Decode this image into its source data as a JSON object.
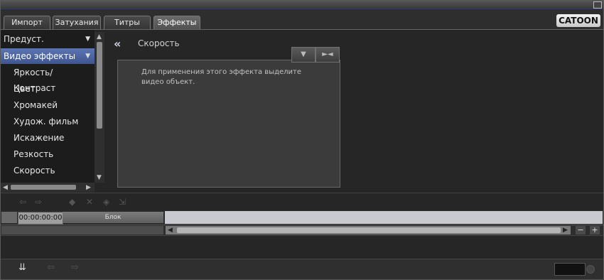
{
  "tabs": [
    "Импорт",
    "Затухания",
    "Титры",
    "Эффекты"
  ],
  "active_tab": "Эффекты",
  "logo_text": "CATOON",
  "sidebar": {
    "preset_dropdown": "Предуст. видеоэфф.",
    "group": "Видео эффекты",
    "items": [
      "Яркость/Контраст",
      "Цвет",
      "Хромакей",
      "Худож. фильм",
      "Искажение",
      "Резкость",
      "Скорость"
    ]
  },
  "effect": {
    "title": "Скорость",
    "hint": "Для применения этого эффекта выделите видео объект."
  },
  "timeline": {
    "timecode": "00:00:00:00",
    "block_label": "Блок"
  },
  "zoom": {
    "minus": "−",
    "plus": "+"
  },
  "colors": {
    "selection": "#4a63a4",
    "track": "#c9cad0"
  }
}
